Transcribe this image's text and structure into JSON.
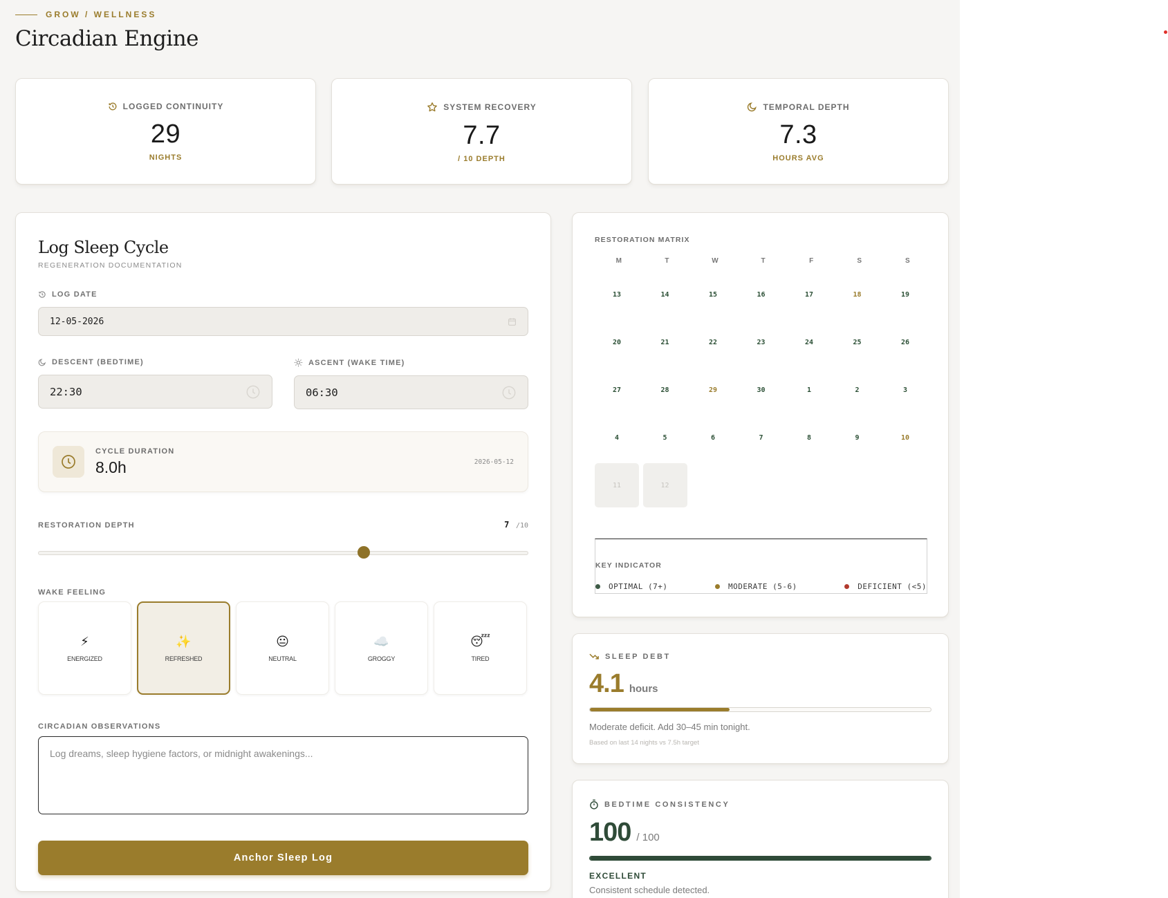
{
  "header": {
    "breadcrumb": "GROW / WELLNESS",
    "title": "Circadian Engine"
  },
  "stats": [
    {
      "label": "LOGGED CONTINUITY",
      "value": "29",
      "unit": "NIGHTS",
      "icon": "history-icon"
    },
    {
      "label": "SYSTEM RECOVERY",
      "value": "7.7",
      "unit": "/ 10 DEPTH",
      "icon": "star-icon"
    },
    {
      "label": "TEMPORAL DEPTH",
      "value": "7.3",
      "unit": "HOURS AVG",
      "icon": "moon-icon"
    }
  ],
  "form": {
    "title": "Log Sleep Cycle",
    "subtitle": "REGENERATION DOCUMENTATION",
    "log_date_label": "LOG DATE",
    "log_date_value": "12-05-2026",
    "bedtime_label": "DESCENT (BEDTIME)",
    "bedtime_value": "22:30",
    "wake_label": "ASCENT (WAKE TIME)",
    "wake_value": "06:30",
    "duration_label": "CYCLE DURATION",
    "duration_value": "8.0h",
    "duration_date": "2026-05-12",
    "depth_label": "RESTORATION DEPTH",
    "depth_value": "7",
    "depth_max": "/10",
    "depth_fraction": 0.7,
    "wake_feeling_label": "WAKE FEELING",
    "feelings": [
      {
        "label": "ENERGIZED",
        "emoji": "⚡",
        "selected": false
      },
      {
        "label": "REFRESHED",
        "emoji": "✨",
        "selected": true
      },
      {
        "label": "NEUTRAL",
        "emoji": "😐",
        "selected": false
      },
      {
        "label": "GROGGY",
        "emoji": "☁️",
        "selected": false
      },
      {
        "label": "TIRED",
        "emoji": "😴",
        "selected": false
      }
    ],
    "observations_label": "CIRCADIAN OBSERVATIONS",
    "observations_placeholder": "Log dreams, sleep hygiene factors, or midnight awakenings...",
    "submit_label": "Anchor Sleep Log"
  },
  "calendar": {
    "title": "RESTORATION MATRIX",
    "weekdays": [
      "M",
      "T",
      "W",
      "T",
      "F",
      "S",
      "S"
    ],
    "days": [
      {
        "d": "13",
        "s": "g"
      },
      {
        "d": "14",
        "s": "g"
      },
      {
        "d": "15",
        "s": "g"
      },
      {
        "d": "16",
        "s": "g"
      },
      {
        "d": "17",
        "s": "g"
      },
      {
        "d": "18",
        "s": "m"
      },
      {
        "d": "19",
        "s": "g"
      },
      {
        "d": "20",
        "s": "g"
      },
      {
        "d": "21",
        "s": "g"
      },
      {
        "d": "22",
        "s": "g"
      },
      {
        "d": "23",
        "s": "g"
      },
      {
        "d": "24",
        "s": "g"
      },
      {
        "d": "25",
        "s": "g"
      },
      {
        "d": "26",
        "s": "g"
      },
      {
        "d": "27",
        "s": "g"
      },
      {
        "d": "28",
        "s": "g"
      },
      {
        "d": "29",
        "s": "m"
      },
      {
        "d": "30",
        "s": "g"
      },
      {
        "d": "1",
        "s": "g"
      },
      {
        "d": "2",
        "s": "g"
      },
      {
        "d": "3",
        "s": "g"
      },
      {
        "d": "4",
        "s": "g"
      },
      {
        "d": "5",
        "s": "g"
      },
      {
        "d": "6",
        "s": "g"
      },
      {
        "d": "7",
        "s": "g"
      },
      {
        "d": "8",
        "s": "g"
      },
      {
        "d": "9",
        "s": "g"
      },
      {
        "d": "10",
        "s": "m"
      },
      {
        "d": "11",
        "s": "e"
      },
      {
        "d": "12",
        "s": "e"
      }
    ],
    "legend_title": "KEY INDICATOR",
    "legend": [
      {
        "label": "OPTIMAL (7+)",
        "color": "#3d5a45"
      },
      {
        "label": "MODERATE (5-6)",
        "color": "#9a7c2c"
      },
      {
        "label": "DEFICIENT (<5)",
        "color": "#b23a2e"
      }
    ]
  },
  "debt": {
    "label": "SLEEP DEBT",
    "value": "4.1",
    "unit": "hours",
    "fraction": 0.41,
    "note": "Moderate deficit. Add 30–45 min tonight.",
    "basis": "Based on last 14 nights vs 7.5h target",
    "color": "#9a7c2c"
  },
  "consistency": {
    "label": "BEDTIME CONSISTENCY",
    "value": "100",
    "max": "/ 100",
    "fraction": 1.0,
    "status": "EXCELLENT",
    "note": "Consistent schedule detected.",
    "color": "#2f4b38"
  }
}
